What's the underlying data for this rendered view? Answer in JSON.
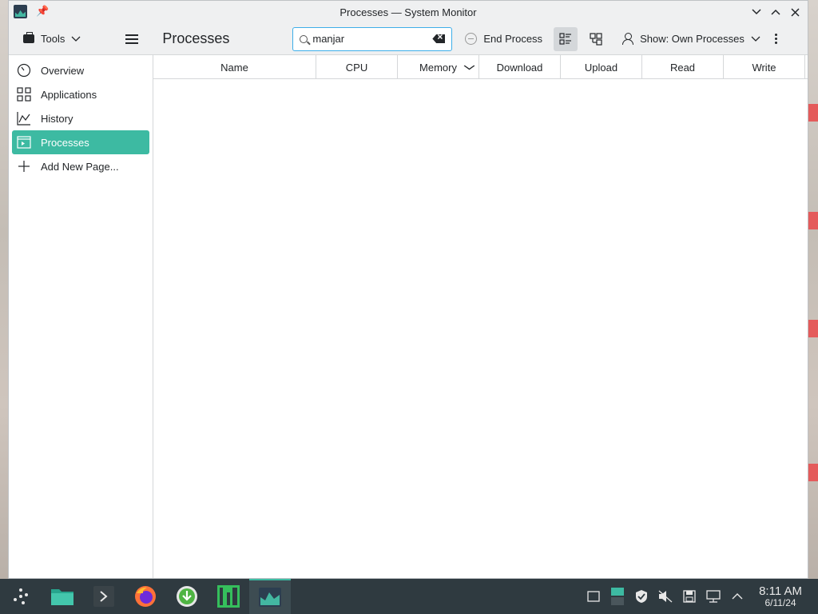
{
  "window": {
    "title": "Processes — System Monitor"
  },
  "toolbar": {
    "tools_label": "Tools",
    "page_heading": "Processes",
    "search_value": "manjar",
    "end_process_label": "End Process",
    "show_label": "Show: Own Processes"
  },
  "sidebar": {
    "items": [
      {
        "label": "Overview",
        "icon": "speedometer-icon",
        "active": false
      },
      {
        "label": "Applications",
        "icon": "grid-icon",
        "active": false
      },
      {
        "label": "History",
        "icon": "chart-line-icon",
        "active": false
      },
      {
        "label": "Processes",
        "icon": "window-icon",
        "active": true
      },
      {
        "label": "Add New Page...",
        "icon": "plus-icon",
        "active": false
      }
    ]
  },
  "table": {
    "columns": [
      "Name",
      "CPU",
      "Memory",
      "Download",
      "Upload",
      "Read",
      "Write"
    ],
    "sorted_column": "Memory",
    "rows": []
  },
  "taskbar": {
    "apps": [
      "app-launcher-icon",
      "file-manager-icon",
      "terminal-icon",
      "firefox-icon",
      "software-updater-icon",
      "manjaro-icon",
      "system-monitor-icon"
    ],
    "clock_time": "8:11 AM",
    "clock_date": "6/11/24"
  },
  "colors": {
    "accent": "#3dbaa2",
    "focus_border": "#3daee9",
    "taskbar": "#2f3a40"
  }
}
